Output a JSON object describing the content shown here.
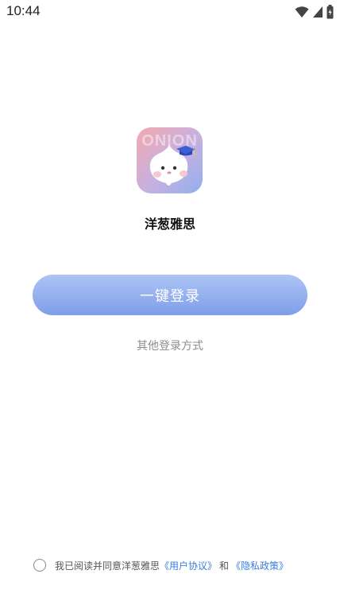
{
  "status_bar": {
    "time": "10:44",
    "icons": [
      "wifi-icon",
      "signal-icon",
      "battery-icon"
    ]
  },
  "app": {
    "logo_watermark": "ONION",
    "name": "洋葱雅思"
  },
  "login": {
    "primary_button_label": "一键登录",
    "other_login_label": "其他登录方式"
  },
  "agreement": {
    "checked": false,
    "prefix": "我已阅读并同意洋葱雅思",
    "user_agreement_link": "《用户协议》",
    "conjunction": "和",
    "privacy_policy_link": "《隐私政策》"
  },
  "colors": {
    "button_gradient_top": "#aec4f6",
    "button_gradient_bottom": "#7e9ee8",
    "link": "#3b7de0",
    "logo_gradient_top_left": "#f2a9b0",
    "logo_gradient_bottom_right": "#8fb0f0"
  }
}
